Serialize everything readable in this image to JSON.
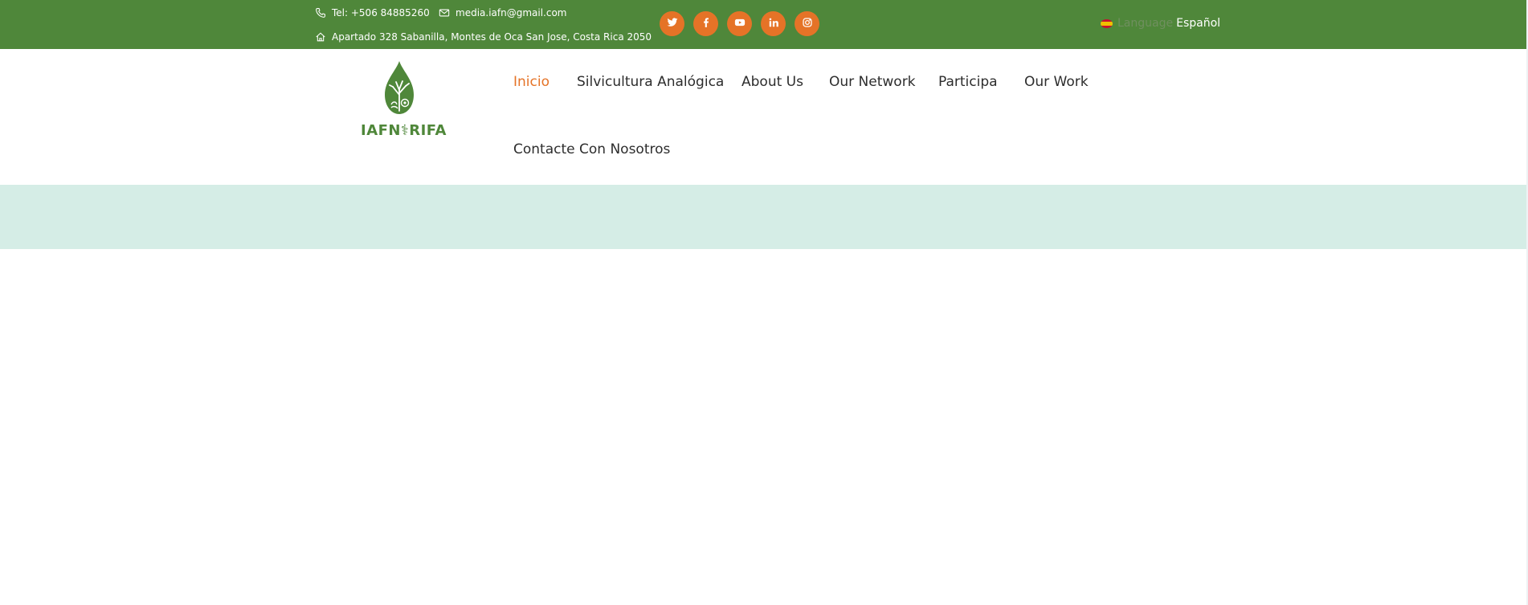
{
  "topbar": {
    "phone": "Tel: +506 84885260",
    "email": "media.iafn@gmail.com",
    "address": "Apartado 328 Sabanilla, Montes de Oca San Jose, Costa Rica 2050",
    "background_color": "#4f873a"
  },
  "socials": [
    {
      "name": "twitter",
      "icon": "twitter-icon"
    },
    {
      "name": "facebook",
      "icon": "facebook-icon"
    },
    {
      "name": "youtube",
      "icon": "youtube-icon"
    },
    {
      "name": "linkedin",
      "icon": "linkedin-icon"
    },
    {
      "name": "instagram",
      "icon": "instagram-icon"
    }
  ],
  "social_button_color": "#e57327",
  "language": {
    "label": "Language",
    "current": "Español",
    "flag": "spain-flag-icon"
  },
  "logo": {
    "text": "IAFN⚕RIFA",
    "icon": "leaf-tree-logo-icon"
  },
  "nav": {
    "items": [
      {
        "label": "Inicio",
        "active": true
      },
      {
        "label": "Silvicultura Analógica",
        "active": false
      },
      {
        "label": "About Us",
        "active": false
      },
      {
        "label": "Our Network",
        "active": false
      },
      {
        "label": "Participa",
        "active": false
      },
      {
        "label": "Our Work",
        "active": false
      },
      {
        "label": "Contacte Con Nosotros",
        "active": false
      }
    ],
    "active_color": "#e57327"
  },
  "band_color": "#d5ede6"
}
